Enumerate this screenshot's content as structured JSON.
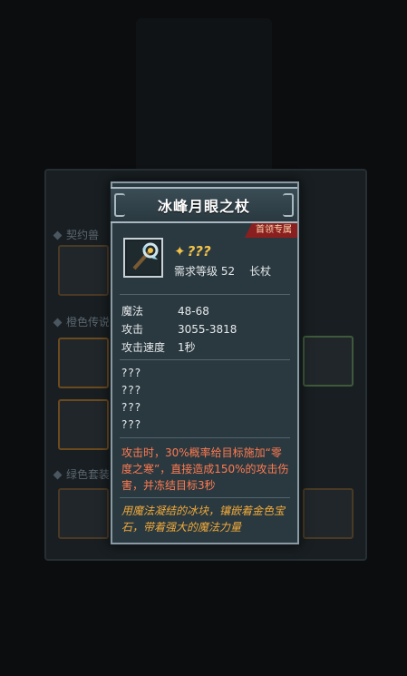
{
  "background": {
    "labels": [
      "契约兽",
      "橙色传说",
      "绿色套装"
    ]
  },
  "item": {
    "name": "冰峰月眼之杖",
    "tag": "首领专属",
    "quality": "???",
    "level_req": "需求等级 52",
    "type": "长杖",
    "stats": [
      {
        "key": "魔法",
        "value": "48-68"
      },
      {
        "key": "攻击",
        "value": "3055-3818"
      },
      {
        "key": "攻击速度",
        "value": "1秒"
      }
    ],
    "unknown_affixes": [
      "???",
      "???",
      "???",
      "???"
    ],
    "effect": "攻击时，30%概率给目标施加“零度之寒”，直接造成150%的攻击伤害，并冻结目标3秒",
    "flavor": "用魔法凝结的冰块，镶嵌着金色宝石，带着强大的魔法力量"
  },
  "colors": {
    "effect": "#ff7a50",
    "flavor": "#f0a93a",
    "quality": "#f1c24a",
    "tag_bg": "#8a1f1f"
  },
  "icons": {
    "item": "staff-icon",
    "quality": "wand-quality-icon"
  }
}
